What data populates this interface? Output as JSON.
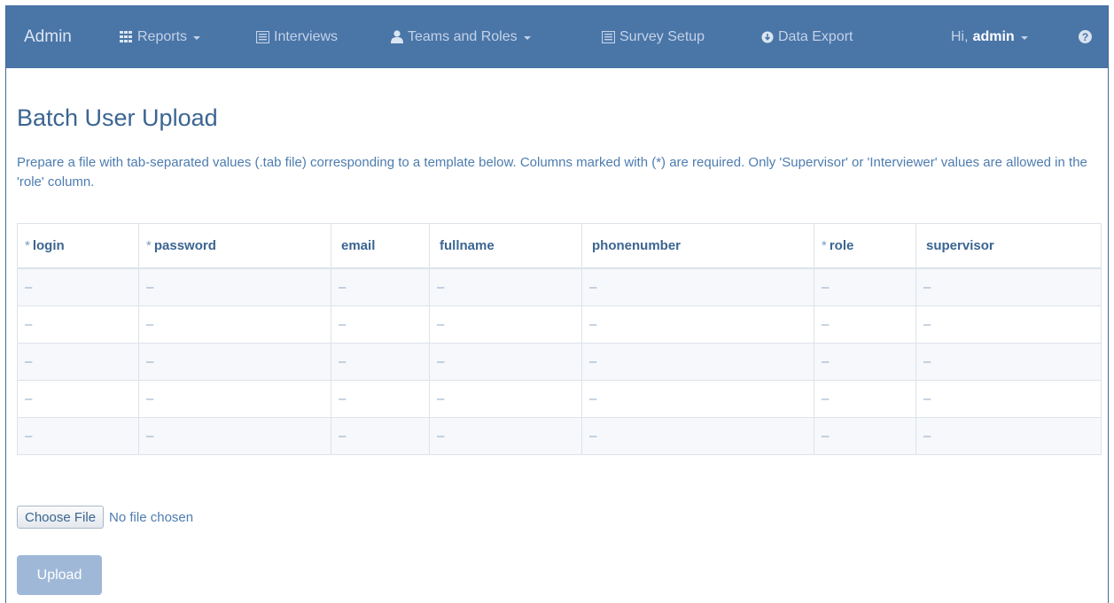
{
  "navbar": {
    "brand": "Admin",
    "reports": "Reports",
    "interviews": "Interviews",
    "teams_and_roles": "Teams and Roles",
    "survey_setup": "Survey Setup",
    "data_export": "Data Export",
    "greeting": "Hi,",
    "username": "admin",
    "help_glyph": "?",
    "color": "#4a75a7"
  },
  "page": {
    "title": "Batch User Upload",
    "description": "Prepare a file with tab-separated values (.tab file) corresponding to a template below. Columns marked with (*) are required. Only 'Supervisor' or 'Interviewer' values are allowed in the 'role' column."
  },
  "template_table": {
    "columns": [
      {
        "required_mark": "*",
        "label": "login"
      },
      {
        "required_mark": "*",
        "label": "password"
      },
      {
        "required_mark": "",
        "label": "email"
      },
      {
        "required_mark": "",
        "label": "fullname"
      },
      {
        "required_mark": "",
        "label": "phonenumber"
      },
      {
        "required_mark": "*",
        "label": "role"
      },
      {
        "required_mark": "",
        "label": "supervisor"
      }
    ],
    "rows": [
      [
        "–",
        "–",
        "–",
        "–",
        "–",
        "–",
        "–"
      ],
      [
        "–",
        "–",
        "–",
        "–",
        "–",
        "–",
        "–"
      ],
      [
        "–",
        "–",
        "–",
        "–",
        "–",
        "–",
        "–"
      ],
      [
        "–",
        "–",
        "–",
        "–",
        "–",
        "–",
        "–"
      ],
      [
        "–",
        "–",
        "–",
        "–",
        "–",
        "–",
        "–"
      ]
    ]
  },
  "file_input": {
    "button_label": "Choose File",
    "status": "No file chosen"
  },
  "upload_button": {
    "label": "Upload"
  }
}
